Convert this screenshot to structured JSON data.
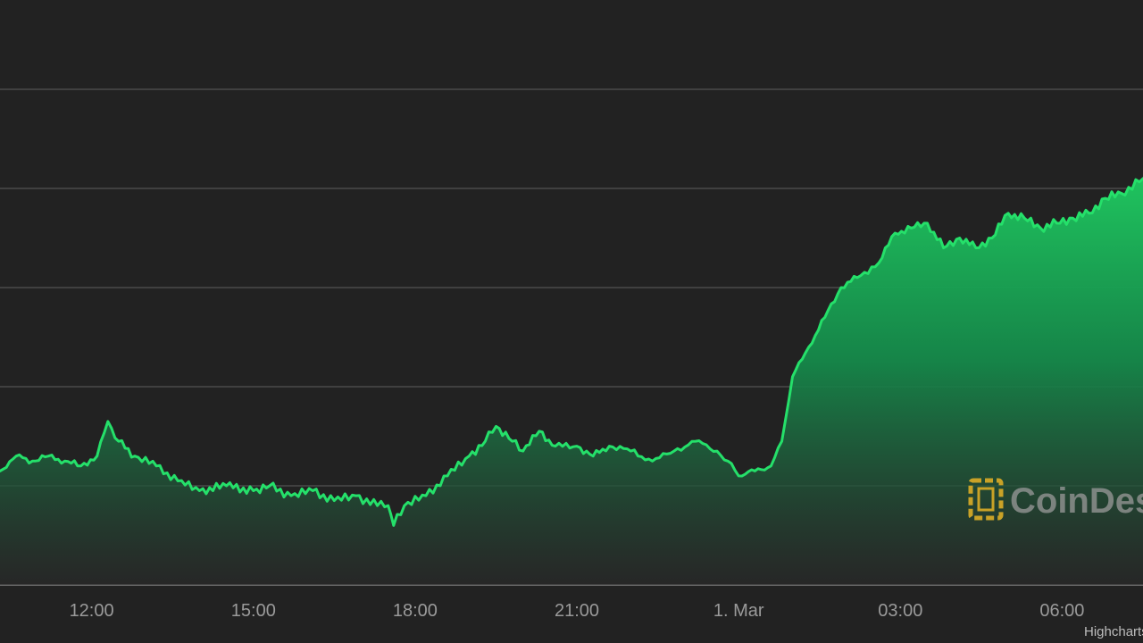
{
  "chart_data": {
    "type": "area",
    "title": "",
    "xlabel": "",
    "ylabel": "",
    "grid": true,
    "legend": "none",
    "x_tick_labels": [
      "12:00",
      "15:00",
      "18:00",
      "21:00",
      "1. Mar",
      "03:00",
      "06:00"
    ],
    "x_ticks_hours": [
      12,
      15,
      18,
      21,
      24,
      27,
      30
    ],
    "xlim_hours": [
      10.3,
      31.5
    ],
    "ylim": [
      0,
      100
    ],
    "y_gridlines": [
      0,
      20,
      40,
      60,
      80,
      100
    ],
    "y_tick_labels_visible": false,
    "series": [
      {
        "color": "#25e06a",
        "points": [
          [
            10.3,
            23
          ],
          [
            10.6,
            26
          ],
          [
            10.9,
            25
          ],
          [
            11.2,
            26
          ],
          [
            11.5,
            25
          ],
          [
            11.8,
            24
          ],
          [
            12.1,
            26
          ],
          [
            12.3,
            33
          ],
          [
            12.5,
            29
          ],
          [
            12.8,
            26
          ],
          [
            13.2,
            24
          ],
          [
            13.6,
            21
          ],
          [
            14.0,
            19
          ],
          [
            14.5,
            20
          ],
          [
            15.0,
            19
          ],
          [
            15.3,
            20
          ],
          [
            15.7,
            18
          ],
          [
            16.1,
            19
          ],
          [
            16.5,
            17
          ],
          [
            16.9,
            18
          ],
          [
            17.3,
            16
          ],
          [
            17.5,
            16
          ],
          [
            17.6,
            12
          ],
          [
            17.8,
            16
          ],
          [
            18.2,
            18
          ],
          [
            18.6,
            22
          ],
          [
            19.0,
            26
          ],
          [
            19.3,
            29
          ],
          [
            19.5,
            32
          ],
          [
            19.8,
            29
          ],
          [
            20.0,
            27
          ],
          [
            20.3,
            31
          ],
          [
            20.6,
            28
          ],
          [
            21.0,
            28
          ],
          [
            21.3,
            26
          ],
          [
            21.6,
            28
          ],
          [
            22.0,
            27
          ],
          [
            22.4,
            25
          ],
          [
            22.8,
            27
          ],
          [
            23.2,
            29
          ],
          [
            23.6,
            27
          ],
          [
            23.8,
            25
          ],
          [
            24.0,
            22
          ],
          [
            24.3,
            23
          ],
          [
            24.6,
            24
          ],
          [
            24.8,
            29
          ],
          [
            25.0,
            42
          ],
          [
            25.3,
            48
          ],
          [
            25.6,
            54
          ],
          [
            25.9,
            60
          ],
          [
            26.2,
            62
          ],
          [
            26.6,
            65
          ],
          [
            26.9,
            71
          ],
          [
            27.2,
            72
          ],
          [
            27.5,
            73
          ],
          [
            27.8,
            68
          ],
          [
            28.1,
            70
          ],
          [
            28.4,
            68
          ],
          [
            28.7,
            70
          ],
          [
            29.0,
            75
          ],
          [
            29.3,
            74
          ],
          [
            29.6,
            72
          ],
          [
            29.9,
            73
          ],
          [
            30.2,
            74
          ],
          [
            30.5,
            75
          ],
          [
            30.8,
            78
          ],
          [
            31.1,
            79
          ],
          [
            31.5,
            82
          ]
        ]
      }
    ]
  },
  "watermark": {
    "brand": "CoinDesk",
    "logo_color": "#c9a227"
  },
  "credits": "Highcharts.com"
}
